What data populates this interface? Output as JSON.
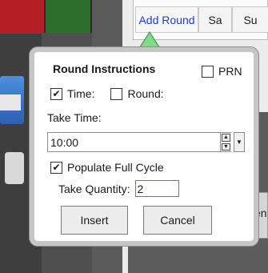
{
  "tabs": [
    {
      "label": "Add Round"
    },
    {
      "label": "Sa"
    },
    {
      "label": "Su"
    }
  ],
  "popup": {
    "title": "Round Instructions",
    "prn": {
      "label": "PRN",
      "checked": false
    },
    "time": {
      "label": "Time:",
      "checked": true
    },
    "round": {
      "label": "Round:",
      "checked": false
    },
    "take_time_label": "Take Time:",
    "take_time_value": "10:00",
    "populate": {
      "label": "Populate Full Cycle",
      "checked": true
    },
    "take_quantity_label": "Take Quantity:",
    "take_quantity_value": "2",
    "insert_label": "Insert",
    "cancel_label": "Cancel"
  },
  "background": {
    "partial_button_text": "en"
  },
  "colors": {
    "tab_link": "#1a40d0",
    "pointer": "#7fdc8d",
    "popup_border": "#c6c6c6"
  }
}
